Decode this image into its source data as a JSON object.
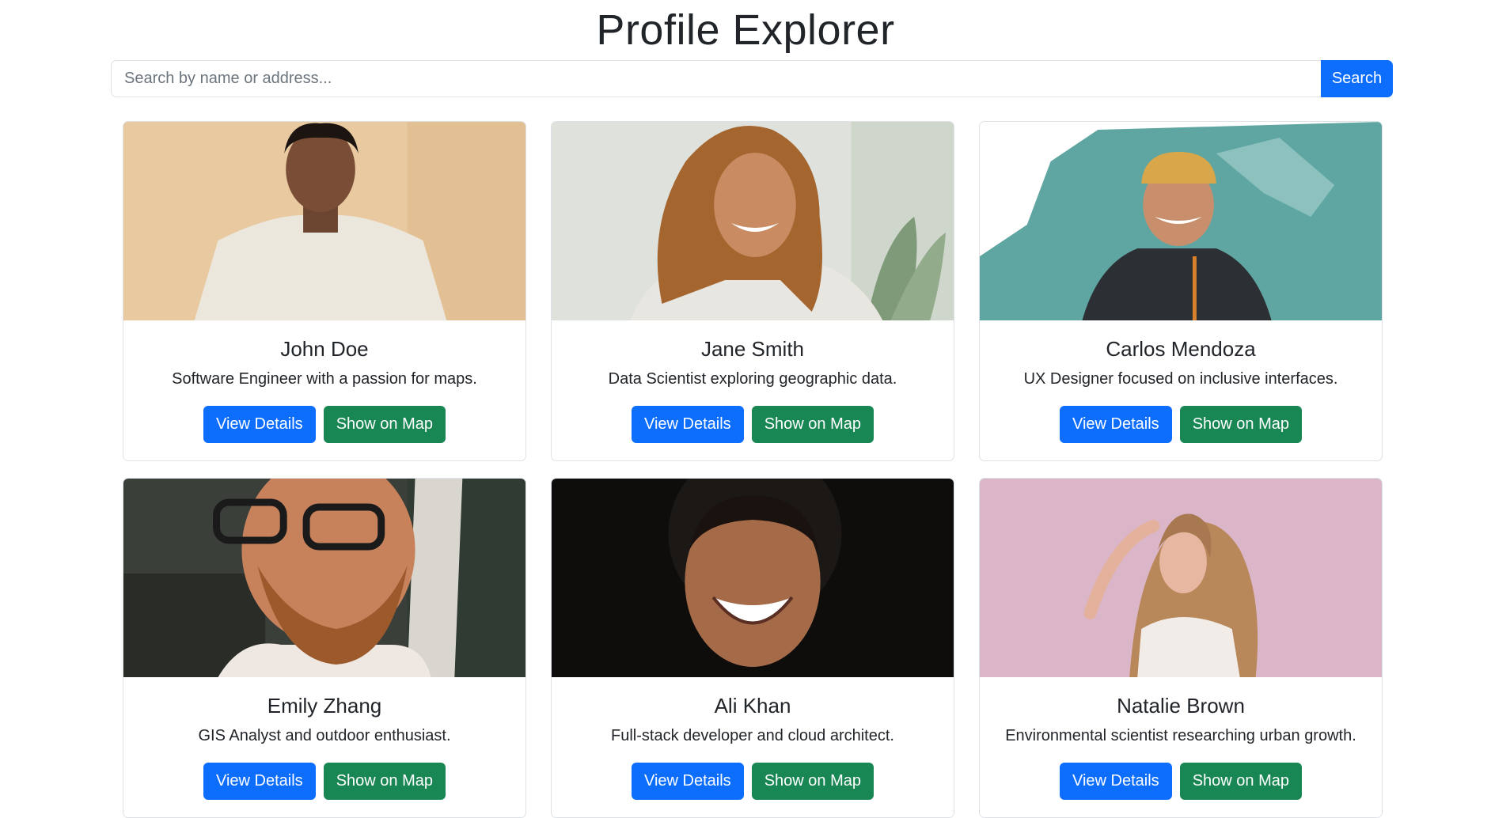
{
  "page": {
    "title": "Profile Explorer"
  },
  "search": {
    "placeholder": "Search by name or address...",
    "value": "",
    "button_label": "Search"
  },
  "colors": {
    "primary": "#0d6efd",
    "success": "#198754",
    "border": "#dee2e6"
  },
  "profiles": [
    {
      "name": "John Doe",
      "description": "Software Engineer with a passion for maps.",
      "details_label": "View Details",
      "map_label": "Show on Map"
    },
    {
      "name": "Jane Smith",
      "description": "Data Scientist exploring geographic data.",
      "details_label": "View Details",
      "map_label": "Show on Map"
    },
    {
      "name": "Carlos Mendoza",
      "description": "UX Designer focused on inclusive interfaces.",
      "details_label": "View Details",
      "map_label": "Show on Map"
    },
    {
      "name": "Emily Zhang",
      "description": "GIS Analyst and outdoor enthusiast.",
      "details_label": "View Details",
      "map_label": "Show on Map"
    },
    {
      "name": "Ali Khan",
      "description": "Full-stack developer and cloud architect.",
      "details_label": "View Details",
      "map_label": "Show on Map"
    },
    {
      "name": "Natalie Brown",
      "description": "Environmental scientist researching urban growth.",
      "details_label": "View Details",
      "map_label": "Show on Map"
    }
  ]
}
